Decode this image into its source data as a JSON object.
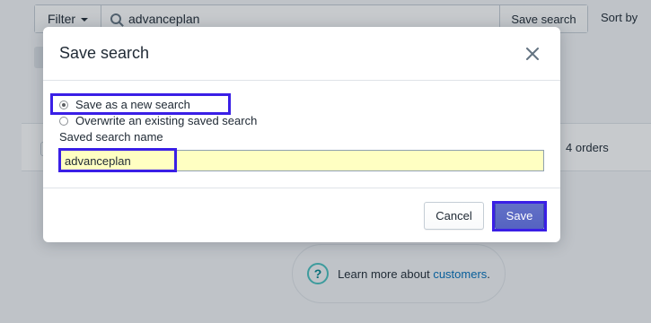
{
  "background": {
    "filter_label": "Filter",
    "search_value": "advanceplan",
    "save_search_label": "Save search",
    "sort_label": "Sort by",
    "row_orders": "4 orders",
    "learn_prefix": "Learn more about ",
    "learn_link": "customers",
    "learn_suffix": "."
  },
  "modal": {
    "title": "Save search",
    "options": [
      {
        "label": "Save as a new search",
        "selected": true
      },
      {
        "label": "Overwrite an existing saved search",
        "selected": false
      }
    ],
    "field_label": "Saved search name",
    "field_value": "advanceplan",
    "cancel_label": "Cancel",
    "save_label": "Save"
  },
  "colors": {
    "highlight": "#3a1fe6",
    "primary": "#5c6ac4",
    "link": "#006fbb",
    "input_bg": "#ffffc2"
  }
}
